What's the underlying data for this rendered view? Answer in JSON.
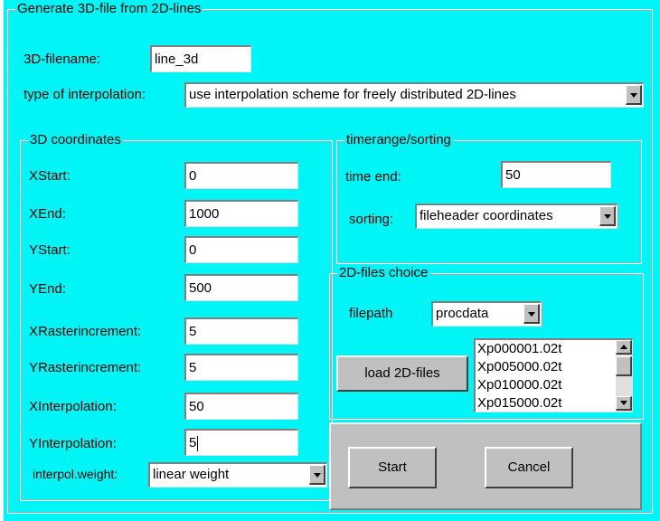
{
  "main_group": {
    "title": "Generate 3D-file from 2D-lines"
  },
  "filename": {
    "label": "3D-filename:",
    "value": "line_3d"
  },
  "interpolation": {
    "label": "type of interpolation:",
    "value": "use interpolation scheme for freely distributed 2D-lines"
  },
  "coords": {
    "title": "3D coordinates",
    "xstart": {
      "label": "XStart:",
      "value": "0"
    },
    "xend": {
      "label": "XEnd:",
      "value": "1000"
    },
    "ystart": {
      "label": "YStart:",
      "value": "0"
    },
    "yend": {
      "label": "YEnd:",
      "value": "500"
    },
    "xraster": {
      "label": "XRasterincrement:",
      "value": "5"
    },
    "yraster": {
      "label": "YRasterincrement:",
      "value": "5"
    },
    "xinterp": {
      "label": "XInterpolation:",
      "value": "50"
    },
    "yinterp": {
      "label": "YInterpolation:",
      "value": "5"
    },
    "weight": {
      "label": "interpol.weight:",
      "value": "linear weight"
    }
  },
  "timerange": {
    "title": "timerange/sorting",
    "time_end": {
      "label": "time end:",
      "value": "50"
    },
    "sorting": {
      "label": "sorting:",
      "value": "fileheader coordinates"
    }
  },
  "files": {
    "title": "2D-files choice",
    "filepath": {
      "label": "filepath",
      "value": "procdata"
    },
    "load_label": "load 2D-files",
    "list": [
      "Xp000001.02t",
      "Xp005000.02t",
      "Xp010000.02t",
      "Xp015000.02t"
    ]
  },
  "actions": {
    "start_label": "Start",
    "cancel_label": "Cancel"
  },
  "colors": {
    "background": "#00f6f6",
    "button_face": "#c0c0c0",
    "field": "#ffffff"
  },
  "icons": {
    "dropdown": "chevron-down-icon",
    "scroll_up": "arrow-up-icon",
    "scroll_down": "arrow-down-icon"
  }
}
